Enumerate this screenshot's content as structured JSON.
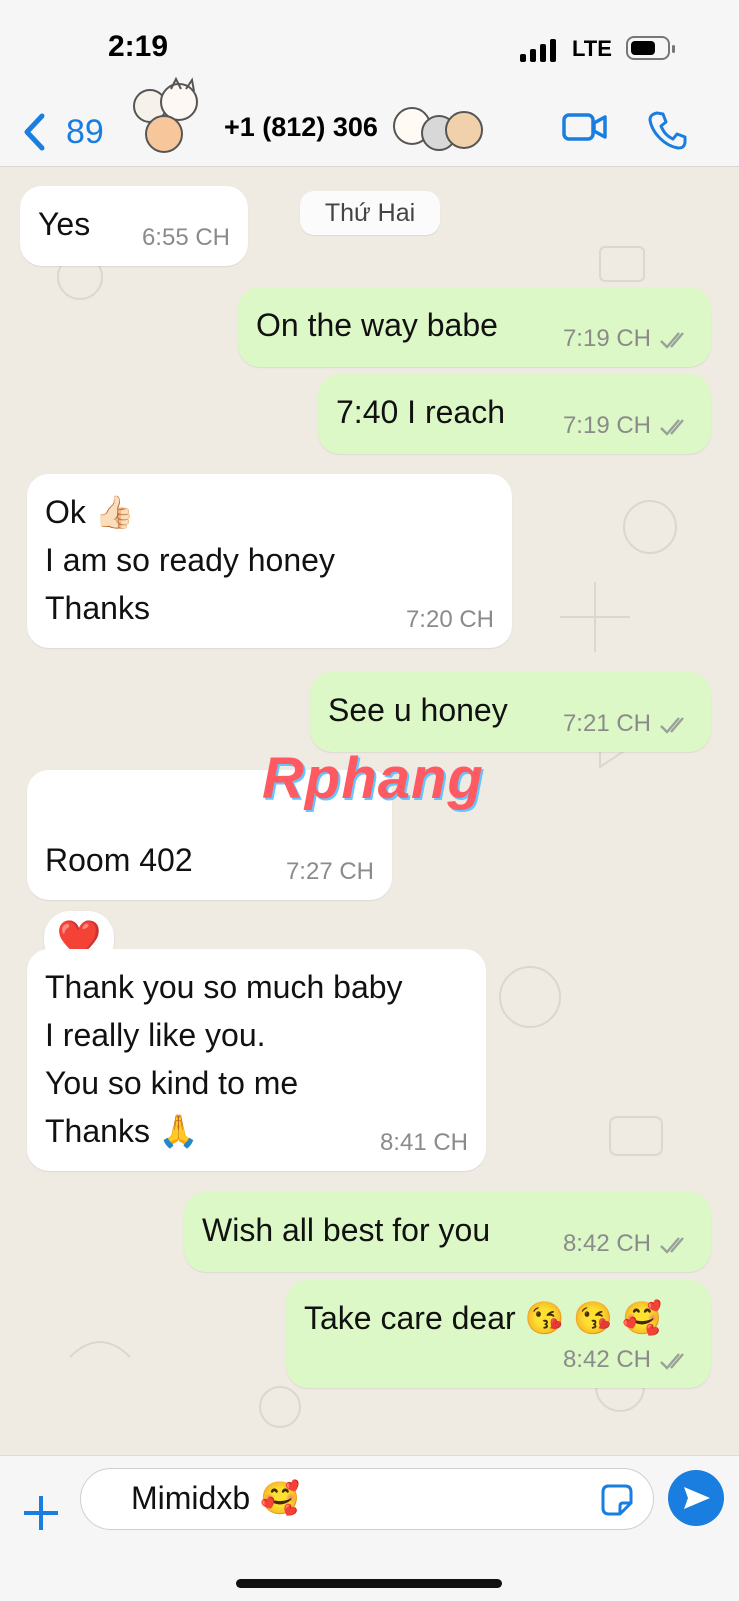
{
  "status_bar": {
    "time": "2:19",
    "network": "LTE"
  },
  "header": {
    "back_count": "89",
    "contact": "+1 (812) 306"
  },
  "date_separator": "Thứ Hai",
  "messages": [
    {
      "lines": [
        "Yes"
      ],
      "time": "6:55 CH",
      "direction": "in"
    },
    {
      "lines": [
        "On the way babe"
      ],
      "time": "7:19 CH",
      "direction": "out"
    },
    {
      "lines": [
        "7:40 I reach"
      ],
      "time": "7:19 CH",
      "direction": "out"
    },
    {
      "lines": [
        "Ok 👍🏻",
        "I am so ready honey",
        "Thanks"
      ],
      "time": "7:20 CH",
      "direction": "in"
    },
    {
      "lines": [
        "See u honey"
      ],
      "time": "7:21 CH",
      "direction": "out"
    },
    {
      "lines": [
        "Room 402"
      ],
      "time": "7:27 CH",
      "direction": "in"
    },
    {
      "lines": [
        "Thank you so much baby",
        "I really like you.",
        "You so kind to me",
        "Thanks 🙏"
      ],
      "time": "8:41 CH",
      "direction": "in"
    },
    {
      "lines": [
        "Wish all best for you"
      ],
      "time": "8:42 CH",
      "direction": "out"
    },
    {
      "lines": [
        "Take care dear 😘 😘 🥰"
      ],
      "time": "8:42 CH",
      "direction": "out"
    }
  ],
  "reaction": "❤️",
  "watermark": "Rphang",
  "composer": {
    "text": "Mimidxb",
    "emoji": "🥰"
  },
  "colors": {
    "incoming": "#ffffff",
    "outgoing": "#dcf8c6",
    "accent": "#1a7de0"
  },
  "icons": [
    "back-chevron-icon",
    "video-call-icon",
    "phone-icon",
    "plus-icon",
    "sticker-icon",
    "send-icon"
  ]
}
